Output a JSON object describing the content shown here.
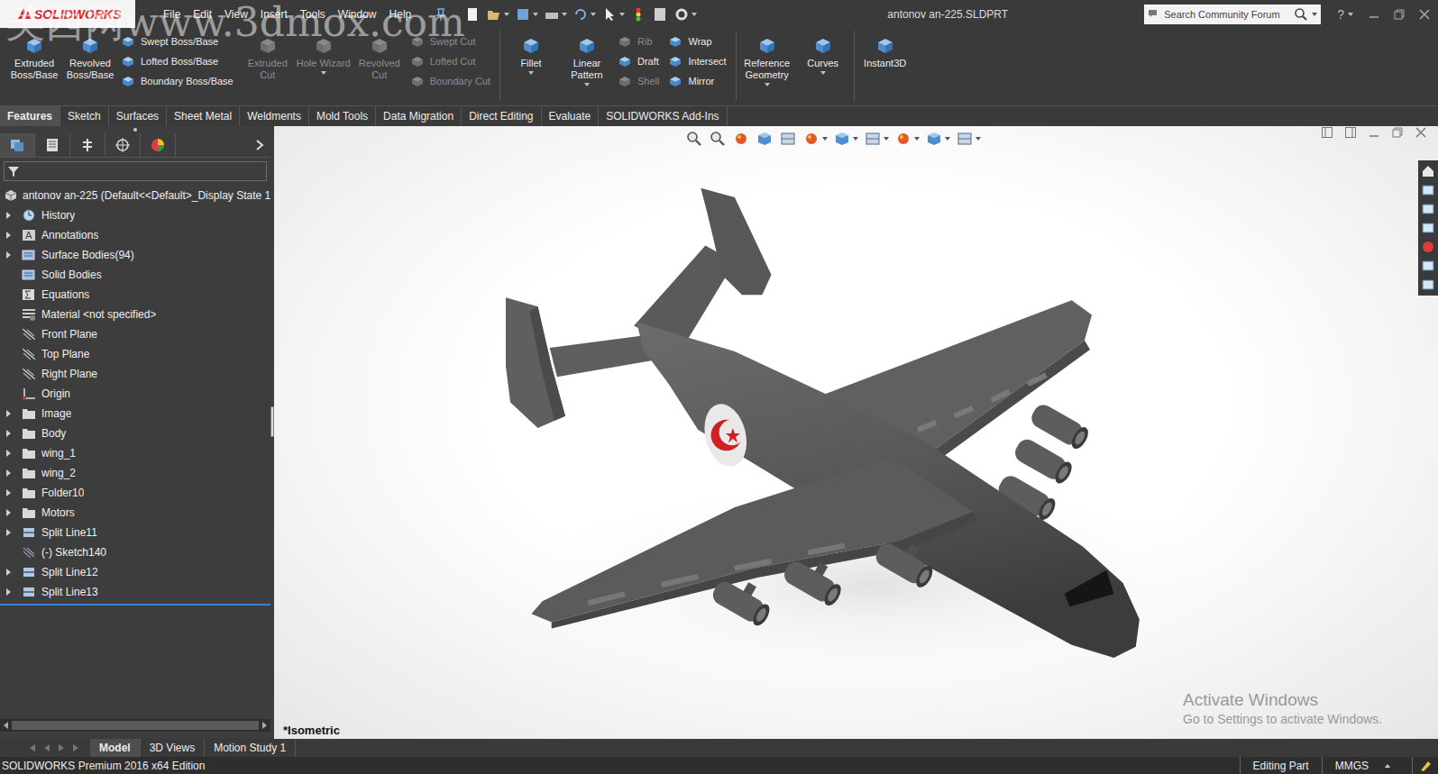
{
  "app": {
    "logo": "SOLIDWORKS",
    "title": "antonov an-225.SLDPRT"
  },
  "watermark": "美西网www.3dmox.com",
  "menu": [
    "File",
    "Edit",
    "View",
    "Insert",
    "Tools",
    "Window",
    "Help"
  ],
  "search": {
    "placeholder": "Search Community Forum"
  },
  "help": "?",
  "command_sections": [
    {
      "columns": [
        {
          "kind": "large",
          "items": [
            {
              "label": "Extruded Boss/Base",
              "disabled": false,
              "dropdown": false
            }
          ]
        },
        {
          "kind": "large",
          "items": [
            {
              "label": "Revolved Boss/Base",
              "disabled": false,
              "dropdown": false
            }
          ]
        },
        {
          "kind": "stack",
          "items": [
            {
              "label": "Swept Boss/Base",
              "disabled": false,
              "dropdown": false
            },
            {
              "label": "Lofted Boss/Base",
              "disabled": false,
              "dropdown": false
            },
            {
              "label": "Boundary Boss/Base",
              "disabled": false,
              "dropdown": false
            }
          ]
        },
        {
          "kind": "large",
          "items": [
            {
              "label": "Extruded Cut",
              "disabled": true,
              "dropdown": false
            }
          ]
        },
        {
          "kind": "large",
          "items": [
            {
              "label": "Hole Wizard",
              "disabled": true,
              "dropdown": true
            }
          ]
        },
        {
          "kind": "large",
          "items": [
            {
              "label": "Revolved Cut",
              "disabled": true,
              "dropdown": false
            }
          ]
        },
        {
          "kind": "stack",
          "items": [
            {
              "label": "Swept Cut",
              "disabled": true,
              "dropdown": false
            },
            {
              "label": "Lofted Cut",
              "disabled": true,
              "dropdown": false
            },
            {
              "label": "Boundary Cut",
              "disabled": true,
              "dropdown": false
            }
          ]
        }
      ]
    },
    {
      "columns": [
        {
          "kind": "large",
          "items": [
            {
              "label": "Fillet",
              "disabled": false,
              "dropdown": true
            }
          ]
        },
        {
          "kind": "large",
          "items": [
            {
              "label": "Linear Pattern",
              "disabled": false,
              "dropdown": true
            }
          ]
        },
        {
          "kind": "stack",
          "items": [
            {
              "label": "Rib",
              "disabled": true,
              "dropdown": false
            },
            {
              "label": "Draft",
              "disabled": false,
              "dropdown": false
            },
            {
              "label": "Shell",
              "disabled": true,
              "dropdown": false
            }
          ]
        },
        {
          "kind": "stack",
          "items": [
            {
              "label": "Wrap",
              "disabled": false,
              "dropdown": false
            },
            {
              "label": "Intersect",
              "disabled": false,
              "dropdown": false
            },
            {
              "label": "Mirror",
              "disabled": false,
              "dropdown": false
            }
          ]
        }
      ]
    },
    {
      "columns": [
        {
          "kind": "large",
          "items": [
            {
              "label": "Reference Geometry",
              "disabled": false,
              "dropdown": true
            }
          ]
        },
        {
          "kind": "large",
          "items": [
            {
              "label": "Curves",
              "disabled": false,
              "dropdown": true
            }
          ]
        }
      ]
    },
    {
      "columns": [
        {
          "kind": "large",
          "items": [
            {
              "label": "Instant3D",
              "disabled": false,
              "dropdown": false
            }
          ]
        }
      ]
    }
  ],
  "tabs": [
    {
      "label": "Features",
      "selected": true
    },
    {
      "label": "Sketch",
      "selected": false
    },
    {
      "label": "Surfaces",
      "selected": false
    },
    {
      "label": "Sheet Metal",
      "selected": false
    },
    {
      "label": "Weldments",
      "selected": false
    },
    {
      "label": "Mold Tools",
      "selected": false
    },
    {
      "label": "Data Migration",
      "selected": false
    },
    {
      "label": "Direct Editing",
      "selected": false
    },
    {
      "label": "Evaluate",
      "selected": false
    },
    {
      "label": "SOLIDWORKS Add-Ins",
      "selected": false
    }
  ],
  "tree": {
    "root": "antonov an-225  (Default<<Default>_Display State 1",
    "items": [
      {
        "label": "History",
        "kind": "history",
        "expandable": true
      },
      {
        "label": "Annotations",
        "kind": "annotation",
        "expandable": true
      },
      {
        "label": "Surface Bodies(94)",
        "kind": "bodies",
        "expandable": true
      },
      {
        "label": "Solid Bodies",
        "kind": "bodies",
        "expandable": false
      },
      {
        "label": "Equations",
        "kind": "equation",
        "expandable": false
      },
      {
        "label": "Material <not specified>",
        "kind": "material",
        "expandable": false
      },
      {
        "label": "Front Plane",
        "kind": "plane",
        "expandable": false
      },
      {
        "label": "Top Plane",
        "kind": "plane",
        "expandable": false
      },
      {
        "label": "Right Plane",
        "kind": "plane",
        "expandable": false
      },
      {
        "label": "Origin",
        "kind": "origin",
        "expandable": false
      },
      {
        "label": "Image",
        "kind": "folder",
        "expandable": true
      },
      {
        "label": "Body",
        "kind": "folder",
        "expandable": true
      },
      {
        "label": "wing_1",
        "kind": "folder",
        "expandable": true
      },
      {
        "label": "wing_2",
        "kind": "folder",
        "expandable": true
      },
      {
        "label": "Folder10",
        "kind": "folder",
        "expandable": true
      },
      {
        "label": "Motors",
        "kind": "folder",
        "expandable": true
      },
      {
        "label": "Split Line11",
        "kind": "feature",
        "expandable": true
      },
      {
        "label": "(-) Sketch140",
        "kind": "sketch",
        "expandable": false
      },
      {
        "label": "Split Line12",
        "kind": "feature",
        "expandable": true
      },
      {
        "label": "Split Line13",
        "kind": "feature",
        "expandable": true
      }
    ]
  },
  "viewport": {
    "view_label": "*Isometric",
    "activation": {
      "title": "Activate Windows",
      "subtitle": "Go to Settings to activate Windows."
    }
  },
  "bottom_tabs": [
    {
      "label": "Model",
      "selected": true
    },
    {
      "label": "3D Views",
      "selected": false
    },
    {
      "label": "Motion Study 1",
      "selected": false
    }
  ],
  "status_bar": {
    "edition": "SOLIDWORKS Premium 2016 x64 Edition",
    "mode": "Editing Part",
    "units": "MMGS"
  }
}
